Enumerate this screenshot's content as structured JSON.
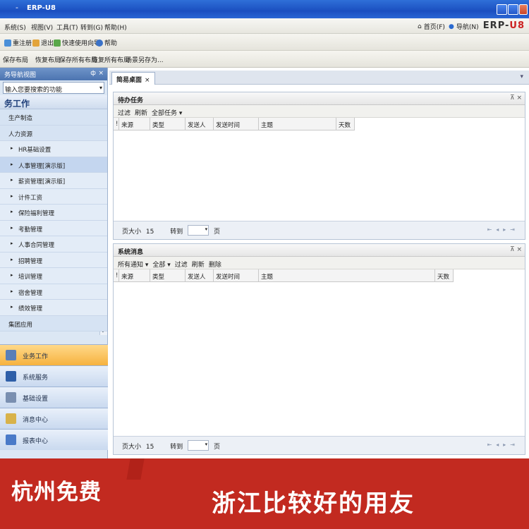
{
  "window": {
    "title": "ERP-U8",
    "dash": "-"
  },
  "menubar": {
    "items": [
      "系统(S)",
      "视图(V)",
      "工具(T)",
      "转到(G)",
      "帮助(H)"
    ],
    "right": [
      "首页(F)",
      "导航(N)"
    ],
    "brand_prefix": "ERP-",
    "brand_suffix": "U8"
  },
  "toolbar1": {
    "items": [
      "重注册",
      "退出",
      "快速使用向导",
      "帮助"
    ]
  },
  "toolbar2": {
    "items": [
      "保存布局",
      "恢复布局",
      "保存所有布局",
      "恢复所有布局",
      "场景另存为..."
    ]
  },
  "nav": {
    "header": "务导航视图",
    "pin": "ф",
    "close": "×",
    "search_placeholder": "输入您要搜索的功能",
    "section": "务工作",
    "rows": [
      {
        "label": "生产制造",
        "kind": "group"
      },
      {
        "label": "人力资源",
        "kind": "group"
      },
      {
        "label": "HR基础设置",
        "kind": "child"
      },
      {
        "label": "人事管理[演示版]",
        "kind": "child",
        "selected": true
      },
      {
        "label": "薪资管理[演示版]",
        "kind": "child"
      },
      {
        "label": "计件工资",
        "kind": "child"
      },
      {
        "label": "保险福利管理",
        "kind": "child"
      },
      {
        "label": "考勤管理",
        "kind": "child"
      },
      {
        "label": "人事合同管理",
        "kind": "child"
      },
      {
        "label": "招聘管理",
        "kind": "child"
      },
      {
        "label": "培训管理",
        "kind": "child"
      },
      {
        "label": "宿舍管理",
        "kind": "child"
      },
      {
        "label": "绩效管理",
        "kind": "child"
      },
      {
        "label": "集团应用",
        "kind": "group"
      }
    ],
    "bottom": [
      {
        "label": "业务工作",
        "icon": "briefcase-icon",
        "active": true
      },
      {
        "label": "系统服务",
        "icon": "system-icon"
      },
      {
        "label": "基础设置",
        "icon": "settings-icon"
      },
      {
        "label": "消息中心",
        "icon": "message-icon"
      },
      {
        "label": "报表中心",
        "icon": "report-icon"
      }
    ]
  },
  "tab": {
    "label": "简易桌面",
    "close": "×",
    "menu": "▾"
  },
  "todo_panel": {
    "title": "待办任务",
    "controls": "⊼ ×",
    "tools": [
      "过滤",
      "刷新",
      "全部任务 ▾"
    ],
    "columns": [
      "!",
      "来源",
      "类型",
      "发送人",
      "发送时间",
      "主题",
      "天数"
    ],
    "pager": {
      "page_size_label": "页大小",
      "page_size": "15",
      "goto_label": "转到",
      "page_suffix": "页"
    }
  },
  "msg_panel": {
    "title": "系统消息",
    "controls": "⊼ ×",
    "tools": [
      "所有通知 ▾",
      "全部 ▾",
      "过滤",
      "刷新",
      "删除"
    ],
    "columns": [
      "!",
      "来源",
      "类型",
      "发送人",
      "发送时间",
      "主题",
      "天数"
    ],
    "pager": {
      "page_size_label": "页大小",
      "page_size": "15",
      "goto_label": "转到",
      "page_suffix": "页"
    }
  },
  "banner": {
    "left": "杭州免费",
    "right": "浙江比较好的用友"
  },
  "colors": {
    "title_bar": "#1b4fc0",
    "nav_bg": "#dce7f4",
    "active_nav": "#f6b23e",
    "banner": "#c22a20"
  }
}
